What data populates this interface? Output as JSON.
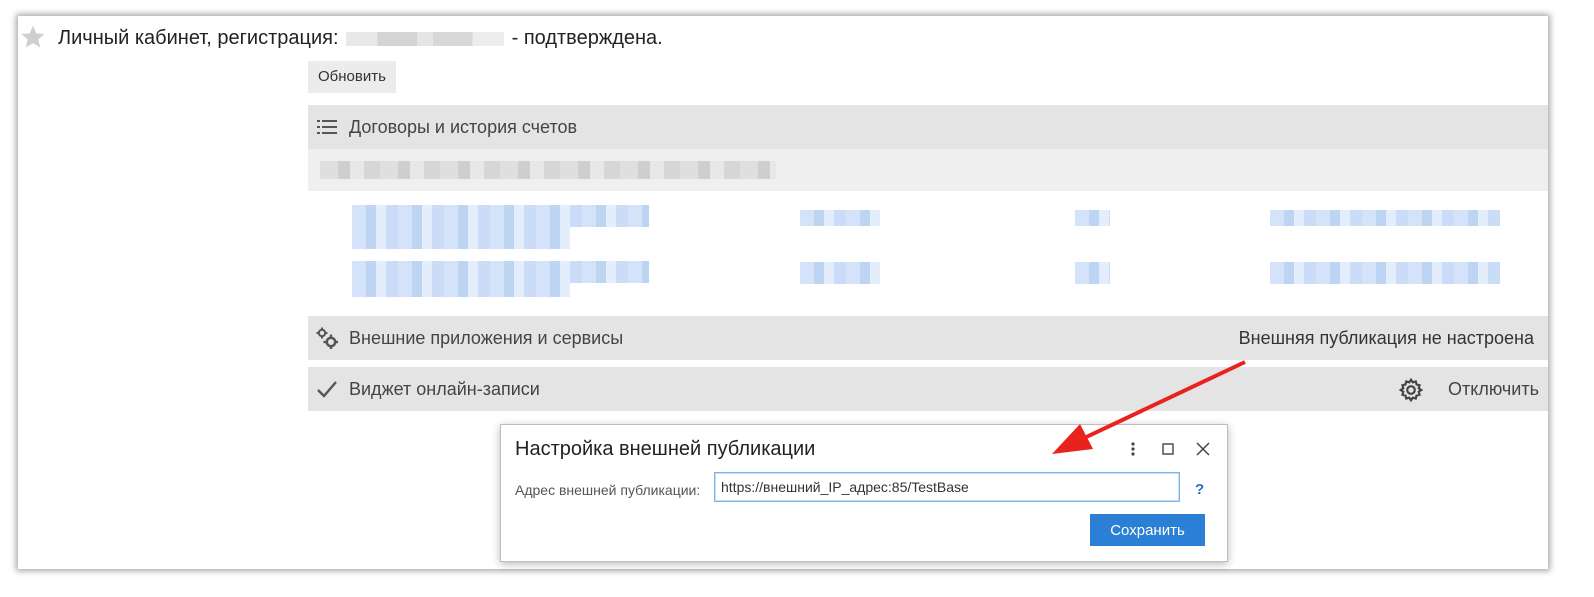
{
  "header": {
    "title_prefix": "Личный кабинет, регистрация:",
    "title_suffix": "- подтверждена."
  },
  "toolbar": {
    "refresh_label": "Обновить"
  },
  "sections": {
    "contracts": {
      "label": "Договоры и история счетов",
      "icon": "list-icon"
    },
    "external_apps": {
      "label": "Внешние приложения и сервисы",
      "status": "Внешняя публикация не настроена",
      "icon": "gears-icon"
    },
    "widget": {
      "label": "Виджет онлайн-записи",
      "action": "Отключить",
      "icon": "checkmark-icon",
      "settings_icon": "gear-icon"
    }
  },
  "dialog": {
    "title": "Настройка внешней публикации",
    "field_label": "Адрес внешней публикации:",
    "field_value": "https://внешний_IP_адрес:85/TestBase",
    "help": "?",
    "save_label": "Сохранить"
  },
  "colors": {
    "accent": "#2b7fd4",
    "section_bg": "#e4e4e4",
    "annotation_arrow": "#e8231e"
  }
}
